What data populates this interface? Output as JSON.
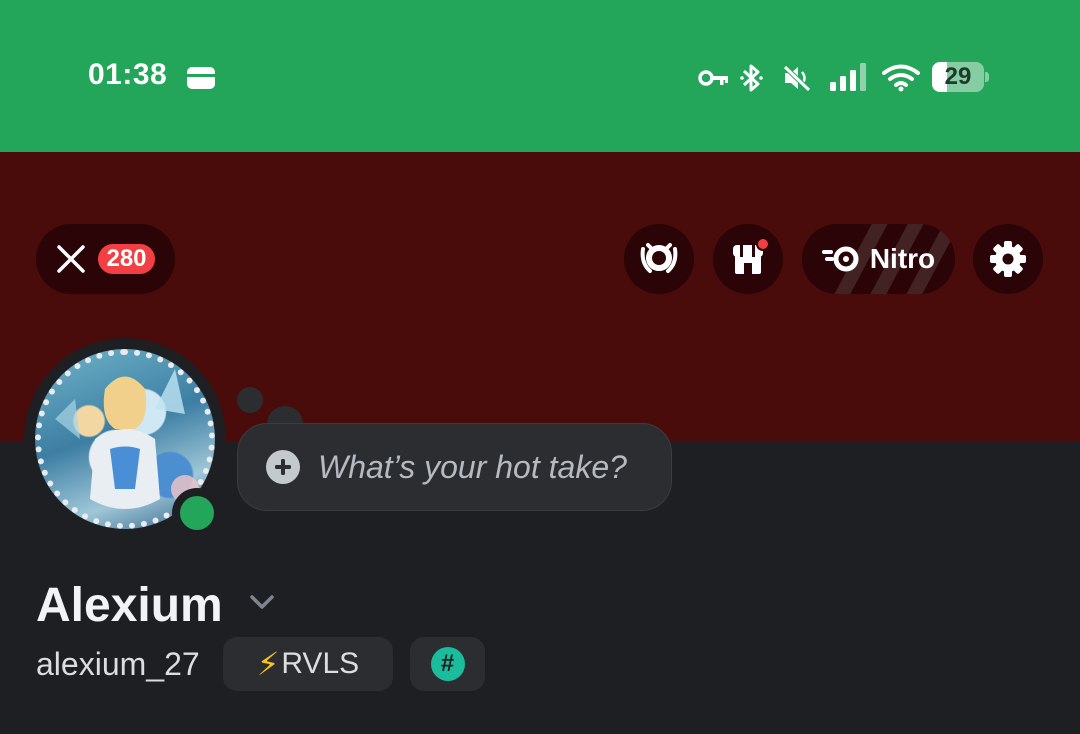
{
  "status_bar": {
    "time": "01:38",
    "battery_level": "29",
    "battery_fraction": 0.29,
    "icons": [
      "wallet-icon",
      "vpn-key-icon",
      "bluetooth-icon",
      "mute-icon",
      "signal-icon",
      "wifi-icon",
      "battery-icon"
    ]
  },
  "header": {
    "close_badge": "280",
    "nitro_label": "Nitro",
    "shop_has_notification": true
  },
  "hot_take": {
    "placeholder": "What’s your hot take?"
  },
  "profile": {
    "display_name": "Alexium",
    "username": "alexium_27",
    "tag_emoji": "⚡",
    "tag_label": "RVLS",
    "hash_symbol": "#",
    "online_status_color": "#23a55a"
  },
  "colors": {
    "status_bar": "#23a55a",
    "banner": "#4a0b0b",
    "background": "#1e1f22",
    "badge_red": "#f23f43"
  }
}
